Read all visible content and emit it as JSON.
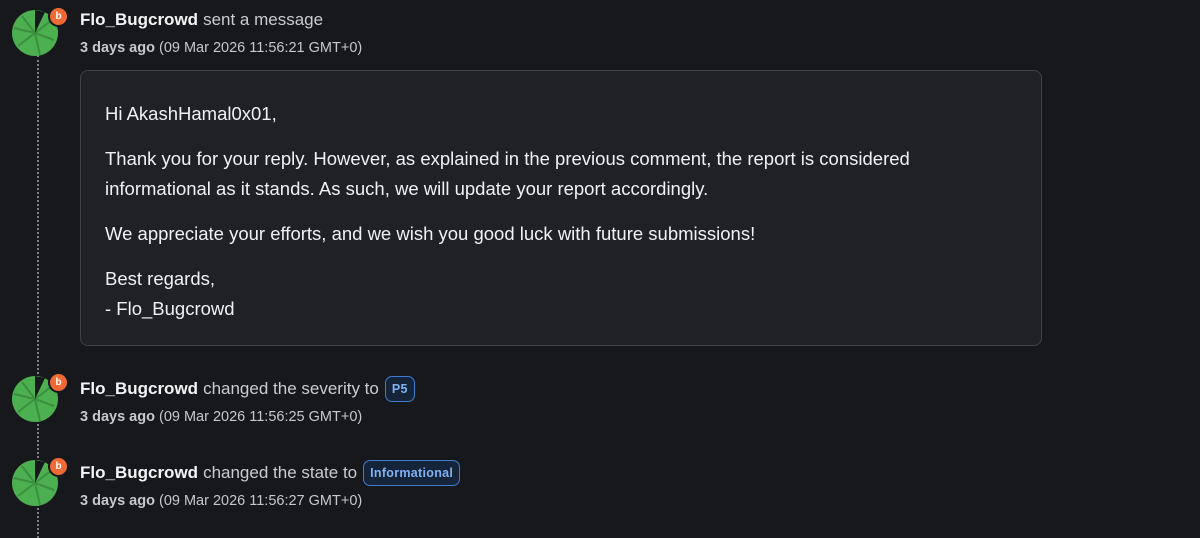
{
  "events": [
    {
      "username": "Flo_Bugcrowd",
      "action": "sent a message",
      "time_ago": "3 days ago",
      "timestamp": "(09 Mar 2026 11:56:21 GMT+0)",
      "badge": "b",
      "avatar_icon": "bugcrowd-lilypad-avatar"
    },
    {
      "username": "Flo_Bugcrowd",
      "action": "changed the severity to",
      "tag": "P5",
      "time_ago": "3 days ago",
      "timestamp": "(09 Mar 2026 11:56:25 GMT+0)",
      "badge": "b",
      "avatar_icon": "bugcrowd-lilypad-avatar"
    },
    {
      "username": "Flo_Bugcrowd",
      "action": "changed the state to",
      "tag": "Informational",
      "time_ago": "3 days ago",
      "timestamp": "(09 Mar 2026 11:56:27 GMT+0)",
      "badge": "b",
      "avatar_icon": "bugcrowd-lilypad-avatar"
    }
  ],
  "message": {
    "greeting": "Hi AkashHamal0x01,",
    "paragraph1": "Thank you for your reply. However, as explained in the previous comment, the report is considered informational as it stands. As such, we will update your report accordingly.",
    "paragraph2": "We appreciate your efforts, and we wish you good luck with future submissions!",
    "closing": "Best regards,",
    "signature": "- Flo_Bugcrowd"
  },
  "colors": {
    "background": "#16181c",
    "card": "#1f2126",
    "badge": "#ef6a34",
    "tag_border": "#3d7ccf",
    "tag_text": "#7fb2f2",
    "avatar_green": "#4caf50"
  }
}
